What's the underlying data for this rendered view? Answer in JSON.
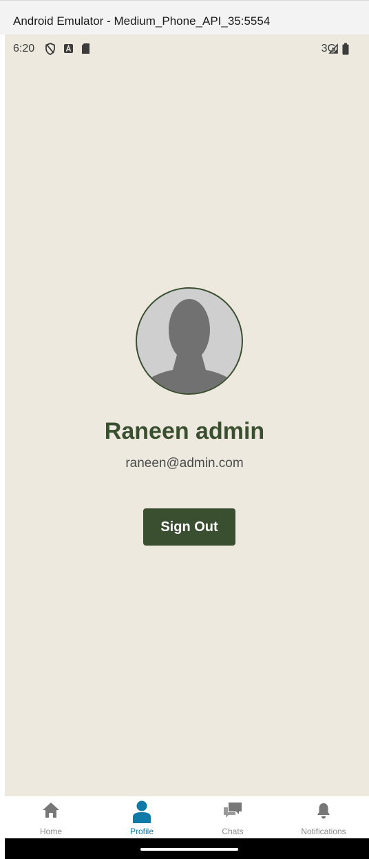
{
  "window": {
    "title": "Android Emulator - Medium_Phone_API_35:5554"
  },
  "status_bar": {
    "time": "6:20",
    "network": "3G",
    "icons": [
      "shield-icon",
      "app-a-icon",
      "sd-card-icon",
      "signal-icon",
      "battery-icon"
    ]
  },
  "profile": {
    "name": "Raneen admin",
    "email": "raneen@admin.com",
    "avatar_icon": "person-silhouette-icon",
    "sign_out_label": "Sign Out"
  },
  "bottom_nav": {
    "active": "Profile",
    "items": [
      {
        "label": "Home",
        "icon": "home-icon"
      },
      {
        "label": "Profile",
        "icon": "person-icon"
      },
      {
        "label": "Chats",
        "icon": "chat-bubbles-icon"
      },
      {
        "label": "Notifications",
        "icon": "bell-icon"
      }
    ]
  },
  "colors": {
    "background": "#ede9df",
    "primary": "#3a4f2f",
    "active_nav": "#0f7aa8",
    "inactive_nav": "#8a8a8a"
  }
}
